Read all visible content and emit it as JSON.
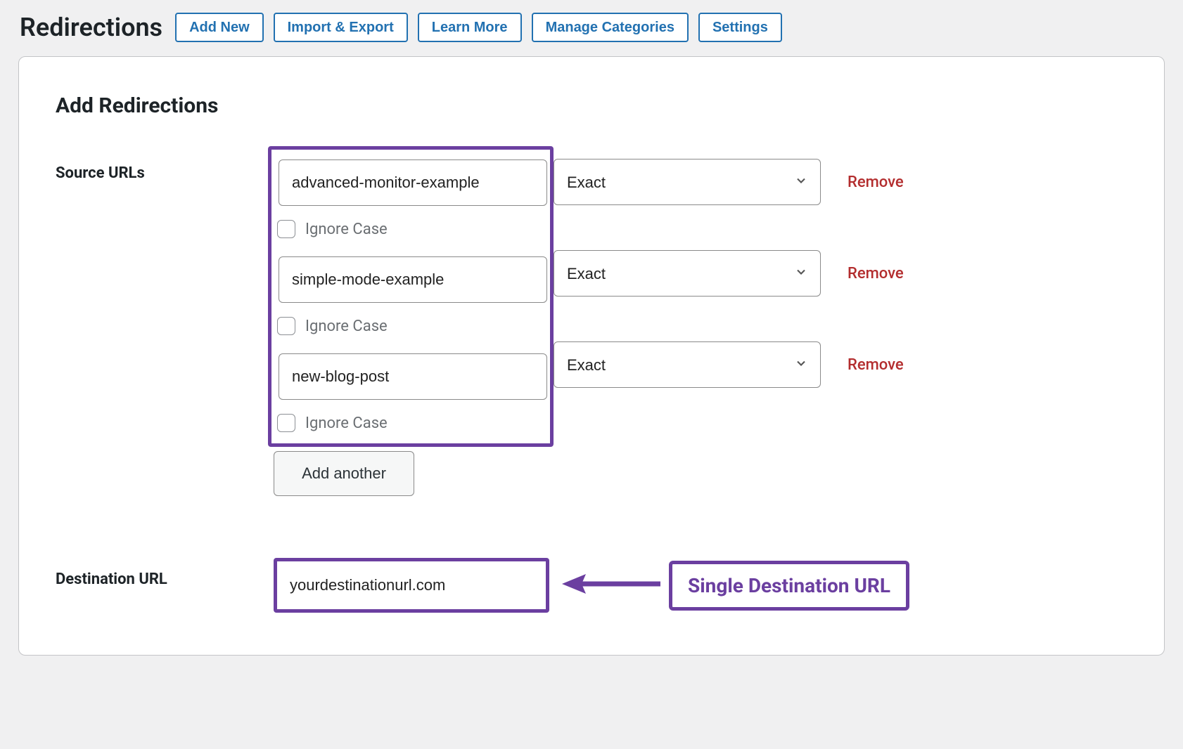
{
  "header": {
    "title": "Redirections",
    "buttons": {
      "add_new": "Add New",
      "import_export": "Import & Export",
      "learn_more": "Learn More",
      "manage_categories": "Manage Categories",
      "settings": "Settings"
    }
  },
  "panel": {
    "title": "Add Redirections",
    "source_label": "Source URLs",
    "destination_label": "Destination URL",
    "ignore_case_label": "Ignore Case",
    "add_another_label": "Add another",
    "remove_label": "Remove",
    "match_option": "Exact",
    "sources": [
      {
        "url": "advanced-monitor-example",
        "match": "Exact",
        "ignore_case": false
      },
      {
        "url": "simple-mode-example",
        "match": "Exact",
        "ignore_case": false
      },
      {
        "url": "new-blog-post",
        "match": "Exact",
        "ignore_case": false
      }
    ],
    "destination_url": "yourdestinationurl.com",
    "callout": "Single Destination URL"
  }
}
